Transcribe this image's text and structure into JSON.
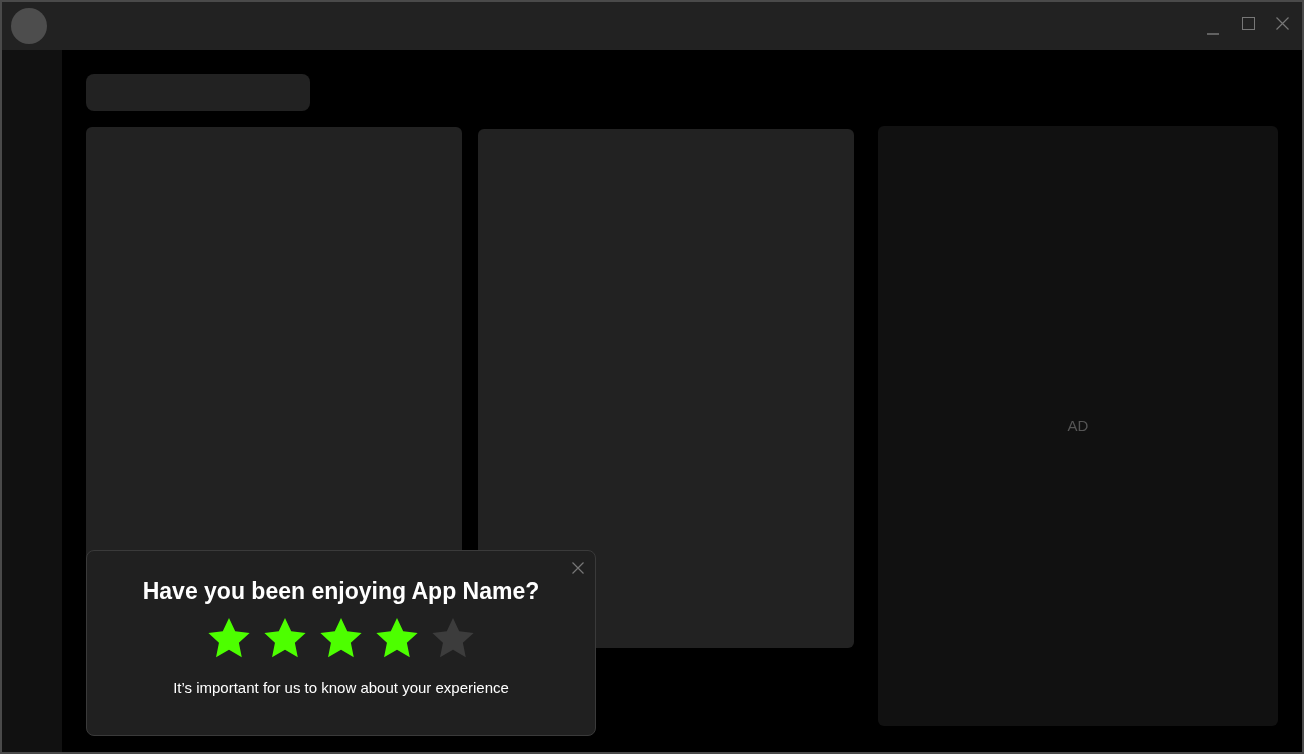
{
  "ad_panel": {
    "label": "AD"
  },
  "rating_popup": {
    "title": "Have you been enjoying App Name?",
    "stars": 4,
    "message": "It’s important for us to know about your experience"
  }
}
